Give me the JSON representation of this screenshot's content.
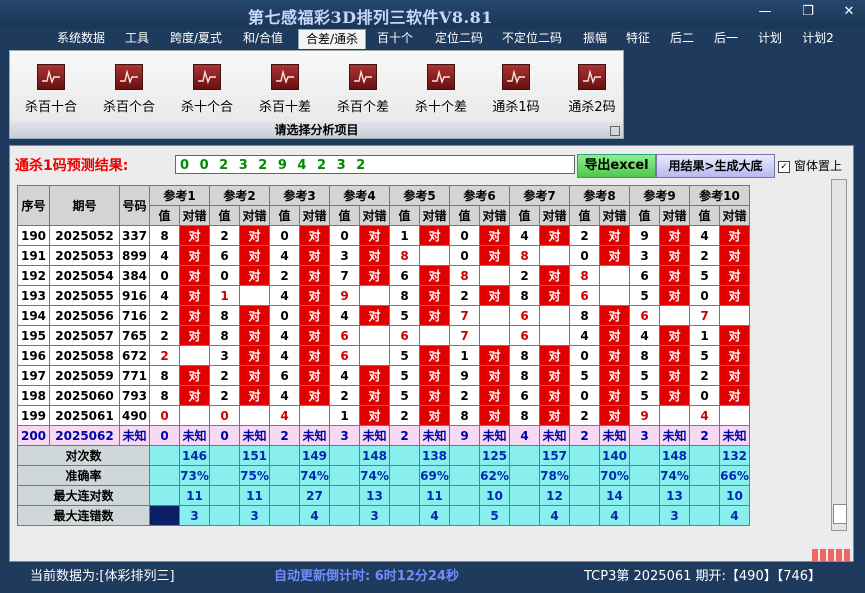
{
  "window": {
    "title": "第七感福彩3D排列三软件V8.81"
  },
  "menu": [
    "系统数据",
    "工具",
    "跨度/夏式",
    "和/合值",
    "合差/通杀",
    "百十个",
    "定位二码",
    "不定位二码",
    "振幅",
    "特征",
    "后二",
    "后一",
    "计划",
    "计划2"
  ],
  "menu_active": 4,
  "ribbon": {
    "buttons": [
      "杀百十合",
      "杀百个合",
      "杀十个合",
      "杀百十差",
      "杀百个差",
      "杀十个差",
      "通杀1码",
      "通杀2码"
    ],
    "caption": "请选择分析项目"
  },
  "result": {
    "label": "通杀1码预测结果:",
    "value": "0 0 2 3 2 9 4 2 3 2",
    "excel_button": "导出excel",
    "gen_button": "用结果>生成大底",
    "top_checkbox": "窗体置上",
    "top_checked": true
  },
  "table": {
    "headers": {
      "seq": "序号",
      "issue": "期号",
      "number": "号码",
      "ref": [
        "参考1",
        "参考2",
        "参考3",
        "参考4",
        "参考5",
        "参考6",
        "参考7",
        "参考8",
        "参考9",
        "参考10"
      ],
      "val": "值",
      "hit": "对错"
    },
    "hit_text": "对",
    "rows": [
      {
        "seq": "190",
        "issue": "2025052",
        "number": "337",
        "cells": [
          [
            "8",
            1
          ],
          [
            "2",
            1
          ],
          [
            "0",
            1
          ],
          [
            "0",
            1
          ],
          [
            "1",
            1
          ],
          [
            "0",
            1
          ],
          [
            "4",
            1
          ],
          [
            "2",
            1
          ],
          [
            "9",
            1
          ],
          [
            "4",
            1
          ]
        ]
      },
      {
        "seq": "191",
        "issue": "2025053",
        "number": "899",
        "cells": [
          [
            "4",
            1
          ],
          [
            "6",
            1
          ],
          [
            "4",
            1
          ],
          [
            "3",
            1
          ],
          [
            "8",
            0
          ],
          [
            "0",
            1
          ],
          [
            "8",
            0
          ],
          [
            "0",
            1
          ],
          [
            "3",
            1
          ],
          [
            "2",
            1
          ]
        ]
      },
      {
        "seq": "192",
        "issue": "2025054",
        "number": "384",
        "cells": [
          [
            "0",
            1
          ],
          [
            "0",
            1
          ],
          [
            "2",
            1
          ],
          [
            "7",
            1
          ],
          [
            "6",
            1
          ],
          [
            "8",
            0
          ],
          [
            "2",
            1
          ],
          [
            "8",
            0
          ],
          [
            "6",
            1
          ],
          [
            "5",
            1
          ]
        ]
      },
      {
        "seq": "193",
        "issue": "2025055",
        "number": "916",
        "cells": [
          [
            "4",
            1
          ],
          [
            "1",
            0
          ],
          [
            "4",
            1
          ],
          [
            "9",
            0
          ],
          [
            "8",
            1
          ],
          [
            "2",
            1
          ],
          [
            "8",
            1
          ],
          [
            "6",
            0
          ],
          [
            "5",
            1
          ],
          [
            "0",
            1
          ]
        ]
      },
      {
        "seq": "194",
        "issue": "2025056",
        "number": "716",
        "cells": [
          [
            "2",
            1
          ],
          [
            "8",
            1
          ],
          [
            "0",
            1
          ],
          [
            "4",
            1
          ],
          [
            "5",
            1
          ],
          [
            "7",
            0
          ],
          [
            "6",
            0
          ],
          [
            "8",
            1
          ],
          [
            "6",
            0
          ],
          [
            "7",
            0
          ]
        ]
      },
      {
        "seq": "195",
        "issue": "2025057",
        "number": "765",
        "cells": [
          [
            "2",
            1
          ],
          [
            "8",
            1
          ],
          [
            "4",
            1
          ],
          [
            "6",
            0
          ],
          [
            "6",
            0
          ],
          [
            "7",
            0
          ],
          [
            "6",
            0
          ],
          [
            "4",
            1
          ],
          [
            "4",
            1
          ],
          [
            "1",
            1
          ]
        ]
      },
      {
        "seq": "196",
        "issue": "2025058",
        "number": "672",
        "cells": [
          [
            "2",
            0
          ],
          [
            "3",
            1
          ],
          [
            "4",
            1
          ],
          [
            "6",
            0
          ],
          [
            "5",
            1
          ],
          [
            "1",
            1
          ],
          [
            "8",
            1
          ],
          [
            "0",
            1
          ],
          [
            "8",
            1
          ],
          [
            "5",
            1
          ]
        ]
      },
      {
        "seq": "197",
        "issue": "2025059",
        "number": "771",
        "cells": [
          [
            "8",
            1
          ],
          [
            "2",
            1
          ],
          [
            "6",
            1
          ],
          [
            "4",
            1
          ],
          [
            "5",
            1
          ],
          [
            "9",
            1
          ],
          [
            "8",
            1
          ],
          [
            "5",
            1
          ],
          [
            "5",
            1
          ],
          [
            "2",
            1
          ]
        ]
      },
      {
        "seq": "198",
        "issue": "2025060",
        "number": "793",
        "cells": [
          [
            "8",
            1
          ],
          [
            "2",
            1
          ],
          [
            "4",
            1
          ],
          [
            "2",
            1
          ],
          [
            "5",
            1
          ],
          [
            "2",
            1
          ],
          [
            "6",
            1
          ],
          [
            "0",
            1
          ],
          [
            "5",
            1
          ],
          [
            "0",
            1
          ]
        ]
      },
      {
        "seq": "199",
        "issue": "2025061",
        "number": "490",
        "cells": [
          [
            "0",
            0
          ],
          [
            "0",
            0
          ],
          [
            "4",
            0
          ],
          [
            "1",
            1
          ],
          [
            "2",
            1
          ],
          [
            "8",
            1
          ],
          [
            "8",
            1
          ],
          [
            "2",
            1
          ],
          [
            "9",
            0
          ],
          [
            "4",
            0
          ]
        ]
      }
    ],
    "predict": {
      "seq": "200",
      "issue": "2025062",
      "number": "未知",
      "values": [
        "0",
        "0",
        "2",
        "3",
        "2",
        "9",
        "4",
        "2",
        "3",
        "2"
      ],
      "unknown": "未知"
    },
    "stats": [
      {
        "label": "对次数",
        "values": [
          "146",
          "151",
          "149",
          "148",
          "138",
          "125",
          "157",
          "140",
          "148",
          "132"
        ]
      },
      {
        "label": "准确率",
        "values": [
          "73%",
          "75%",
          "74%",
          "74%",
          "69%",
          "62%",
          "78%",
          "70%",
          "74%",
          "66%"
        ]
      },
      {
        "label": "最大连对数",
        "values": [
          "11",
          "11",
          "27",
          "13",
          "11",
          "10",
          "12",
          "14",
          "13",
          "10"
        ]
      },
      {
        "label": "最大连错数",
        "values": [
          "3",
          "3",
          "4",
          "3",
          "4",
          "5",
          "4",
          "4",
          "3",
          "4"
        ]
      }
    ]
  },
  "status": {
    "current": "当前数据为:[体彩排列三]",
    "countdown": "自动更新倒计时:  6时12分24秒",
    "draw": "TCP3第 2025061 期开:【490】【746】"
  },
  "colors": {
    "hit": "#e00000",
    "stat_bg": "#88eeee",
    "predict_bg": "#f6d9f2",
    "title": "#c9d6ff",
    "status_blue": "#6f8dff"
  }
}
